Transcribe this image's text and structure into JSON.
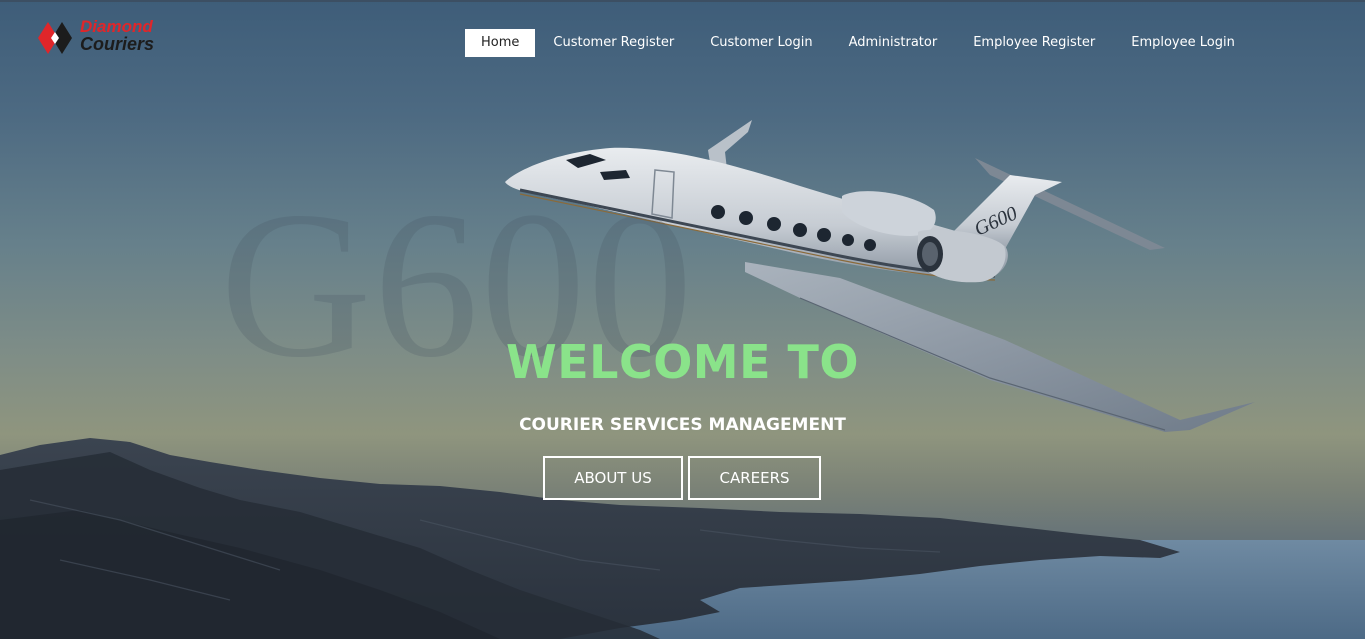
{
  "brand": {
    "name_line1": "Diamond",
    "name_line2": "Couriers",
    "accent_color": "#e0262a"
  },
  "nav": {
    "items": [
      {
        "label": "Home",
        "active": true
      },
      {
        "label": "Customer Register",
        "active": false
      },
      {
        "label": "Customer Login",
        "active": false
      },
      {
        "label": "Administrator",
        "active": false
      },
      {
        "label": "Employee Register",
        "active": false
      },
      {
        "label": "Employee Login",
        "active": false
      }
    ]
  },
  "background": {
    "watermark_text": "G600",
    "jet_tail_text": "G600"
  },
  "hero": {
    "title": "WELCOME TO",
    "title_color": "#8ae38a",
    "subtitle": "COURIER SERVICES MANAGEMENT",
    "buttons": {
      "about": "ABOUT US",
      "careers": "CAREERS"
    }
  }
}
